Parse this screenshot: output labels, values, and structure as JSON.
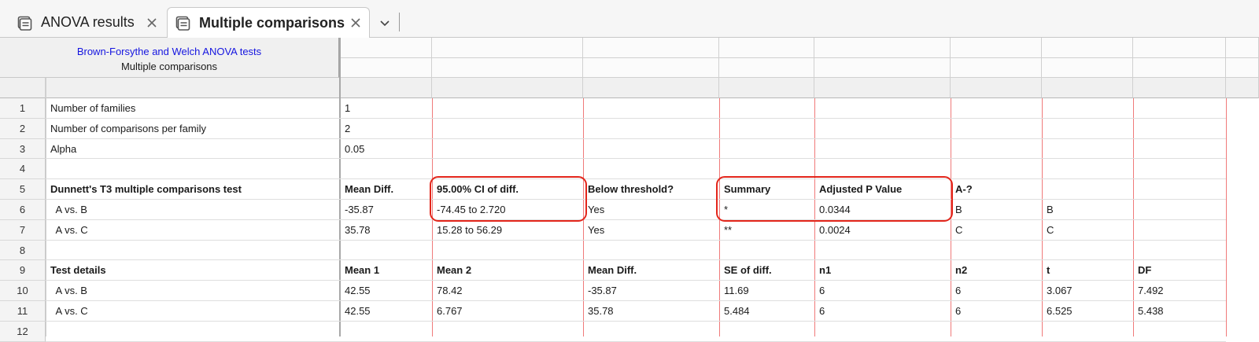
{
  "tabs": [
    {
      "label": "ANOVA results",
      "icon": "table-sheet-icon",
      "active": false
    },
    {
      "label": "Multiple comparisons",
      "icon": "table-sheet-icon",
      "active": true
    }
  ],
  "sheet": {
    "title_line1": "Brown-Forsythe and Welch ANOVA tests",
    "title_line2": "Multiple comparisons"
  },
  "rows": [
    {
      "num": "1",
      "cells": [
        "Number of families",
        "1",
        "",
        "",
        "",
        "",
        "",
        "",
        ""
      ]
    },
    {
      "num": "2",
      "cells": [
        "Number of comparisons per family",
        "2",
        "",
        "",
        "",
        "",
        "",
        "",
        ""
      ]
    },
    {
      "num": "3",
      "cells": [
        "Alpha",
        "0.05",
        "",
        "",
        "",
        "",
        "",
        "",
        ""
      ]
    },
    {
      "num": "4",
      "cells": [
        "",
        "",
        "",
        "",
        "",
        "",
        "",
        "",
        ""
      ]
    },
    {
      "num": "5",
      "bold": true,
      "cells": [
        "Dunnett's T3 multiple comparisons test",
        "Mean Diff.",
        "95.00% CI of diff.",
        "Below threshold?",
        "Summary",
        "Adjusted P Value",
        "A-?",
        "",
        ""
      ]
    },
    {
      "num": "6",
      "cells": [
        "  A vs. B",
        "-35.87",
        "-74.45 to 2.720",
        "Yes",
        "*",
        "0.0344",
        "B",
        "B",
        ""
      ]
    },
    {
      "num": "7",
      "cells": [
        "  A vs. C",
        "35.78",
        "15.28 to 56.29",
        "Yes",
        "**",
        "0.0024",
        "C",
        "C",
        ""
      ]
    },
    {
      "num": "8",
      "cells": [
        "",
        "",
        "",
        "",
        "",
        "",
        "",
        "",
        ""
      ]
    },
    {
      "num": "9",
      "bold": true,
      "cells": [
        "Test details",
        "Mean 1",
        "Mean 2",
        "Mean Diff.",
        "SE of diff.",
        "n1",
        "n2",
        "t",
        "DF"
      ]
    },
    {
      "num": "10",
      "cells": [
        "  A vs. B",
        "42.55",
        "78.42",
        "-35.87",
        "11.69",
        "6",
        "6",
        "3.067",
        "7.492"
      ]
    },
    {
      "num": "11",
      "cells": [
        "  A vs. C",
        "42.55",
        "6.767",
        "35.78",
        "5.484",
        "6",
        "6",
        "6.525",
        "5.438"
      ]
    },
    {
      "num": "12",
      "cells": [
        "",
        "",
        "",
        "",
        "",
        "",
        "",
        "",
        ""
      ]
    }
  ],
  "colors": {
    "highlight": "#e3261b",
    "title_link": "#1515e0",
    "column_divider": "#f07a7a"
  }
}
